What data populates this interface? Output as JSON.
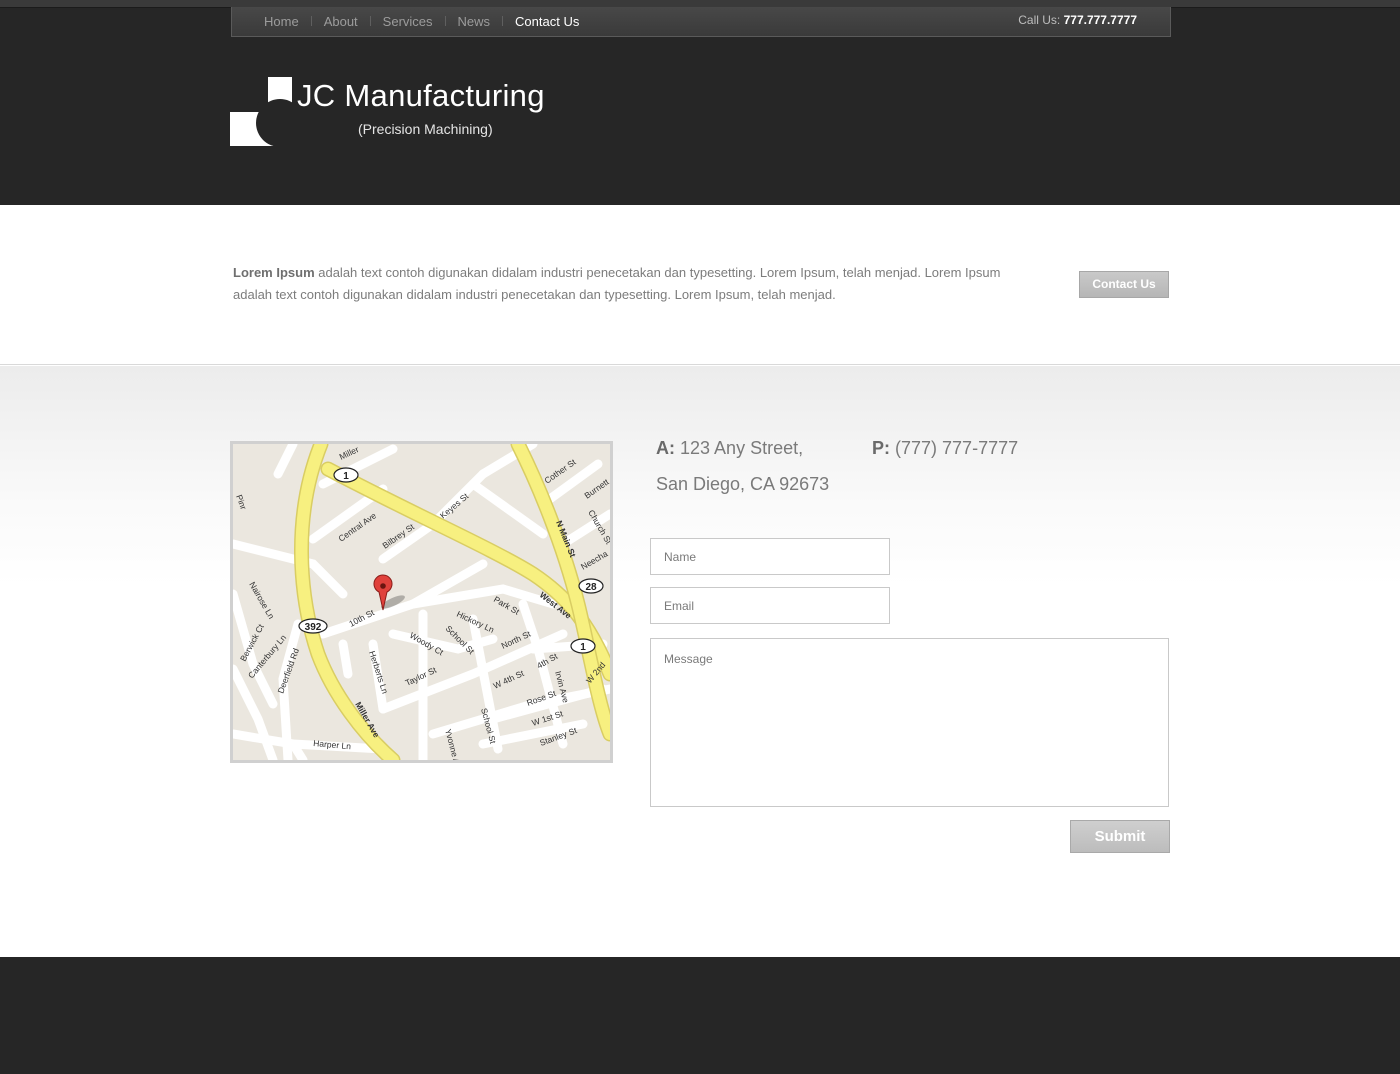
{
  "nav": {
    "items": [
      {
        "label": "Home",
        "active": false
      },
      {
        "label": "About",
        "active": false
      },
      {
        "label": "Services",
        "active": false
      },
      {
        "label": "News",
        "active": false
      },
      {
        "label": "Contact Us",
        "active": true
      }
    ],
    "call_label": "Call Us:",
    "call_number": "777.777.7777"
  },
  "logo": {
    "title": "JC Manufacturing",
    "subtitle": "(Precision Machining)"
  },
  "intro": {
    "bold": "Lorem Ipsum",
    "text": " adalah text contoh digunakan didalam industri penecetakan dan typesetting. Lorem Ipsum, telah menjad. Lorem Ipsum adalah text contoh digunakan didalam industri penecetakan dan typesetting. Lorem Ipsum, telah menjad.",
    "button": "Contact Us"
  },
  "contact": {
    "address_label": "A:",
    "address_line1": "123 Any Street,",
    "address_line2": "San Diego, CA 92673",
    "phone_label": "P:",
    "phone": "(777) 777-7777",
    "form": {
      "name_placeholder": "Name",
      "email_placeholder": "Email",
      "message_placeholder": "Message",
      "submit": "Submit"
    }
  },
  "map": {
    "streets": [
      "Miller",
      "Central Ave",
      "Bilbrey St",
      "Keyes St",
      "Cother St",
      "Burnett",
      "Church St",
      "N Main St",
      "Neecha",
      "West Ave",
      "Park St",
      "Hickory Ln",
      "School St",
      "North St",
      "10th St",
      "Woody Ct",
      "Herberts Ln",
      "Taylor St",
      "W 4th St",
      "4th St",
      "Irvin Ave",
      "W 2nd",
      "Rose St",
      "W 1st St",
      "Stanley St",
      "School St",
      "Yvonne A",
      "Miller Ave",
      "Harper Ln",
      "Deerfield Rd",
      "Canterbury Ln",
      "Berwick Ct",
      "Nairose Ln",
      "Pinr"
    ],
    "route_shields": [
      "1",
      "392",
      "28",
      "1"
    ],
    "colors": {
      "land": "#ebe7df",
      "road": "#ffffff",
      "highway": "#f7f080",
      "pin": "#e0413b"
    }
  }
}
